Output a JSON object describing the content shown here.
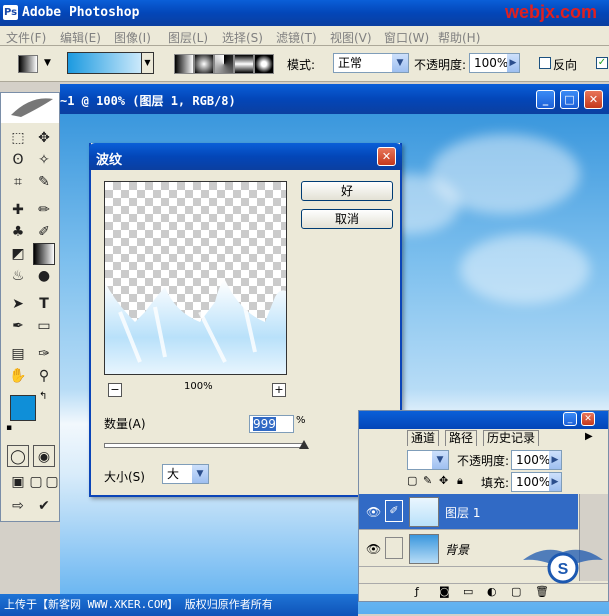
{
  "app": {
    "title": "Adobe Photoshop",
    "watermark": "webjx.com"
  },
  "menu": [
    "文件(F)",
    "编辑(E)",
    "图像(I)",
    "图层(L)",
    "选择(S)",
    "滤镜(T)",
    "视图(V)",
    "窗口(W)",
    "帮助(H)"
  ],
  "options": {
    "mode_label": "模式:",
    "mode_value": "正常",
    "opacity_label": "不透明度:",
    "opacity_value": "100%",
    "reverse_label": "反向"
  },
  "document": {
    "title": "~1 @ 100% (图层 1, RGB/8)"
  },
  "dialog": {
    "title": "波纹",
    "ok_label": "好",
    "cancel_label": "取消",
    "zoom_label": "100%",
    "amount_label": "数量(A)",
    "amount_value": "999",
    "amount_unit": "%",
    "size_label": "大小(S)",
    "size_value": "大",
    "zoom_out": "−",
    "zoom_in": "+"
  },
  "layers_panel": {
    "tabs": [
      "通道",
      "路径",
      "历史记录"
    ],
    "opacity_label": "不透明度:",
    "opacity_value": "100%",
    "fill_label": "填充:",
    "fill_value": "100%",
    "layers": [
      {
        "name": "图层 1",
        "selected": true
      },
      {
        "name": "背景",
        "selected": false
      }
    ]
  },
  "status": {
    "text": "上传于【新客网 WWW.XKER.COM】 版权归原作者所有"
  },
  "colors": {
    "foreground": "#0f8fd8",
    "background": "#ffffff",
    "accent": "#316ac5"
  }
}
